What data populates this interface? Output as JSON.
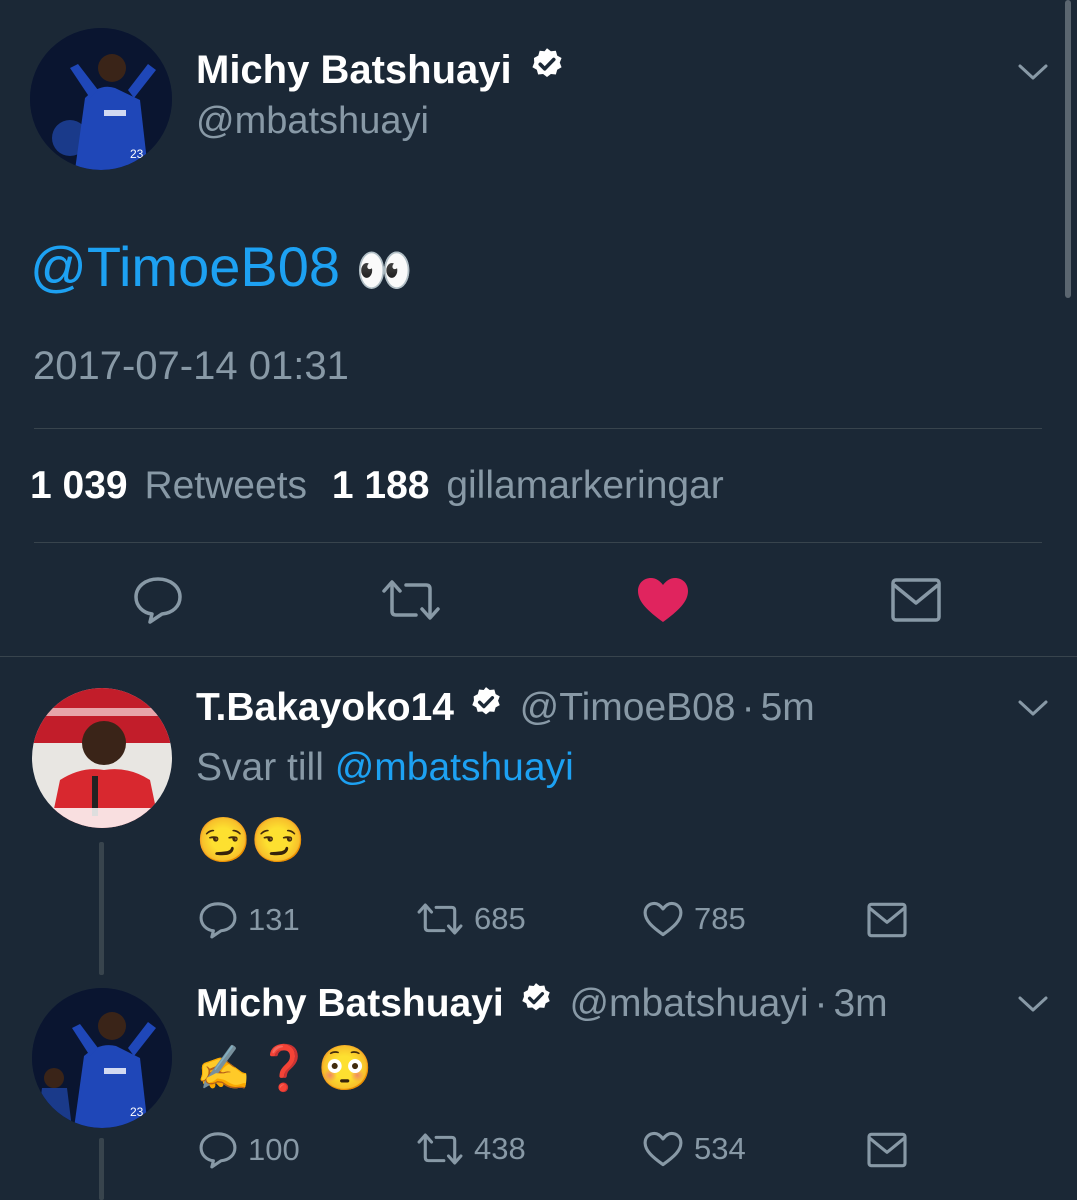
{
  "main_tweet": {
    "author_name": "Michy Batshuayi",
    "author_handle": "@mbatshuayi",
    "mention": "@TimoeB08",
    "emoji": "👀",
    "timestamp": "2017-07-14 01:31",
    "retweets_count": "1 039",
    "retweets_label": "Retweets",
    "likes_count": "1 188",
    "likes_label": "gillamarkeringar"
  },
  "replies": [
    {
      "author_name": "T.Bakayoko14",
      "author_handle": "@TimoeB08",
      "separator": "·",
      "time": "5m",
      "reply_prefix": "Svar till",
      "reply_to": "@mbatshuayi",
      "text": "😏😏",
      "reply_count": "131",
      "retweet_count": "685",
      "like_count": "785"
    },
    {
      "author_name": "Michy Batshuayi",
      "author_handle": "@mbatshuayi",
      "separator": "·",
      "time": "3m",
      "text": "✍️❓😳",
      "reply_count": "100",
      "retweet_count": "438",
      "like_count": "534"
    }
  ],
  "colors": {
    "background": "#1b2836",
    "link": "#1da1f2",
    "muted": "#8899a6",
    "like_active": "#e0245e",
    "divider": "#38444d"
  }
}
